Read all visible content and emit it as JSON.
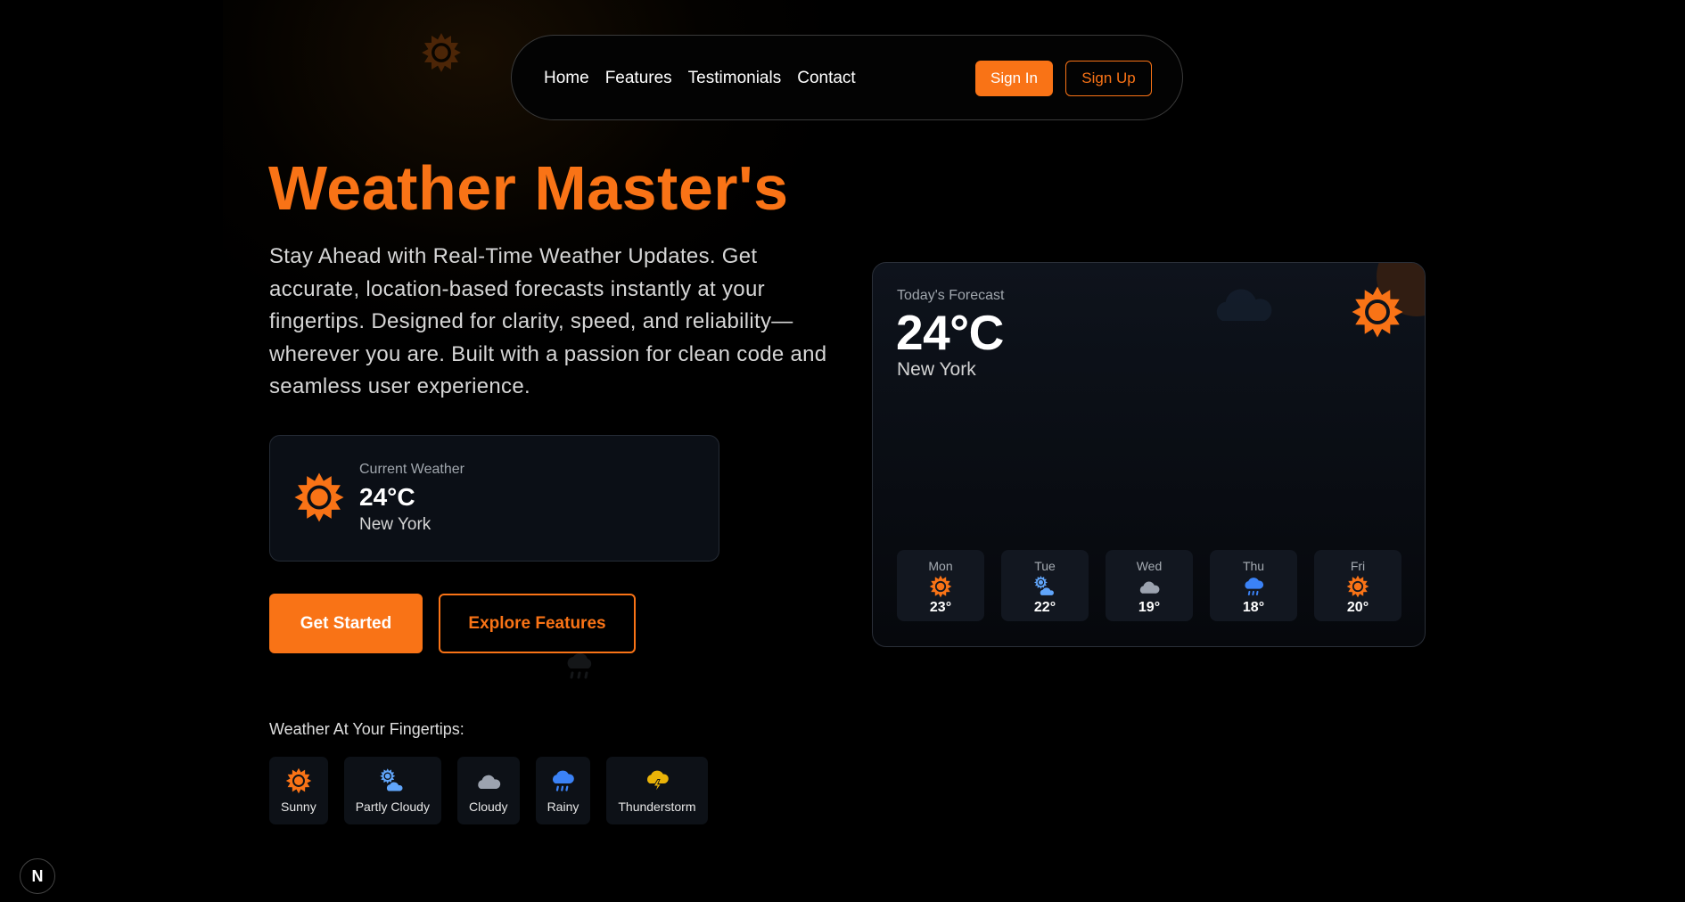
{
  "nav": {
    "links": [
      "Home",
      "Features",
      "Testimonials",
      "Contact"
    ],
    "sign_in": "Sign In",
    "sign_up": "Sign Up"
  },
  "hero": {
    "title": "Weather Master's",
    "description": "Stay Ahead with Real-Time Weather Updates. Get accurate, location-based forecasts instantly at your fingertips. Designed for clarity, speed, and reliability—wherever you are. Built with a passion for clean code and seamless user experience.",
    "current": {
      "label": "Current Weather",
      "temp": "24°C",
      "city": "New York",
      "icon": "sun-icon"
    },
    "get_started": "Get Started",
    "explore": "Explore Features"
  },
  "fingertips": {
    "title": "Weather At Your Fingertips:",
    "items": [
      {
        "label": "Sunny",
        "icon": "sun-icon"
      },
      {
        "label": "Partly Cloudy",
        "icon": "partly-cloudy-icon"
      },
      {
        "label": "Cloudy",
        "icon": "cloud-icon"
      },
      {
        "label": "Rainy",
        "icon": "rain-icon"
      },
      {
        "label": "Thunderstorm",
        "icon": "thunderstorm-icon"
      }
    ]
  },
  "forecast": {
    "label": "Today's Forecast",
    "temp": "24°C",
    "city": "New York",
    "days": [
      {
        "day": "Mon",
        "temp": "23°",
        "icon": "sun-icon"
      },
      {
        "day": "Tue",
        "temp": "22°",
        "icon": "partly-cloudy-icon"
      },
      {
        "day": "Wed",
        "temp": "19°",
        "icon": "cloud-icon"
      },
      {
        "day": "Thu",
        "temp": "18°",
        "icon": "rain-icon"
      },
      {
        "day": "Fri",
        "temp": "20°",
        "icon": "sun-icon"
      }
    ]
  },
  "badge": "N",
  "colors": {
    "accent": "#f97316",
    "background": "#000000",
    "card": "#0b0f16",
    "rain_blue": "#3b82f6",
    "cloud_gray": "#9ca3af",
    "storm_yellow": "#eab308"
  }
}
